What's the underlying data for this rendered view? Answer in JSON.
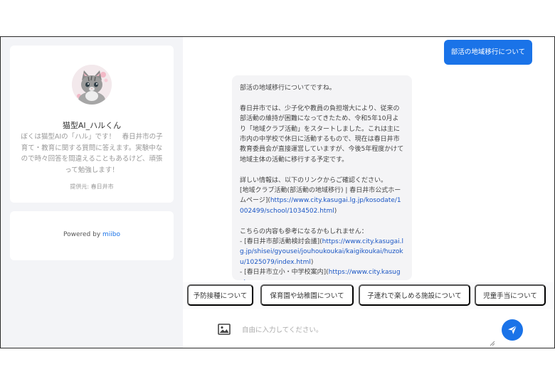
{
  "sidebar": {
    "bot": {
      "name": "猫型AI_ハルくん",
      "description": "ぼくは猫型AIの「ハル」です！　春日井市の子育て・教育に関する質問に答えます。実験中なので時々回答を間違えることもあるけど、頑張って勉強します！",
      "provider": "提供元: 春日井市",
      "avatar_icon": "cat-avatar-icon"
    },
    "powered_by": {
      "prefix": "Powered by ",
      "brand": "miibo",
      "brand_color": "#1a73e8"
    }
  },
  "chat": {
    "user_message": "部活の地域移行について",
    "bot_message": {
      "p1": "部活の地域移行についてですね。",
      "p2": "春日井市では、少子化や教員の負担増大により、従来の部活動の維持が困難になってきたため、令和5年10月より「地域クラブ活動」をスタートしました。これは主に市内の中学校で休日に活動するもので、現在は春日井市教育委員会が直接運営していますが、今後5年程度かけて地域主体の活動に移行する予定です。",
      "p3_intro": "詳しい情報は、以下のリンクからご確認ください。",
      "p3_text": "[地域クラブ活動(部活動の地域移行) | 春日井市公式ホームページ](",
      "p3_link": "https://www.city.kasugai.lg.jp/kosodate/1002499/school/1034502.html",
      "p3_close": ")",
      "p4_intro": "こちらの内容も参考になるかもしれません：",
      "p4_item1_text": "- [春日井市部活動検討会議](",
      "p4_item1_link": "https://www.city.kasugai.lg.jp/shisei/gyousei/jouhoukoukai/kaigikoukai/huzoku/1025079/index.html",
      "p4_item1_close": ")",
      "p4_item2_text": "- [春日井市立小・中学校案内](",
      "p4_item2_link": "https://www.city.kasugai."
    },
    "suggestions": [
      "予防接種について",
      "保育園や幼稚園について",
      "子連れで楽しめる施設について",
      "児童手当について"
    ],
    "input": {
      "placeholder": "自由に入力してください。",
      "value": ""
    },
    "accent_color": "#1a73e8"
  }
}
